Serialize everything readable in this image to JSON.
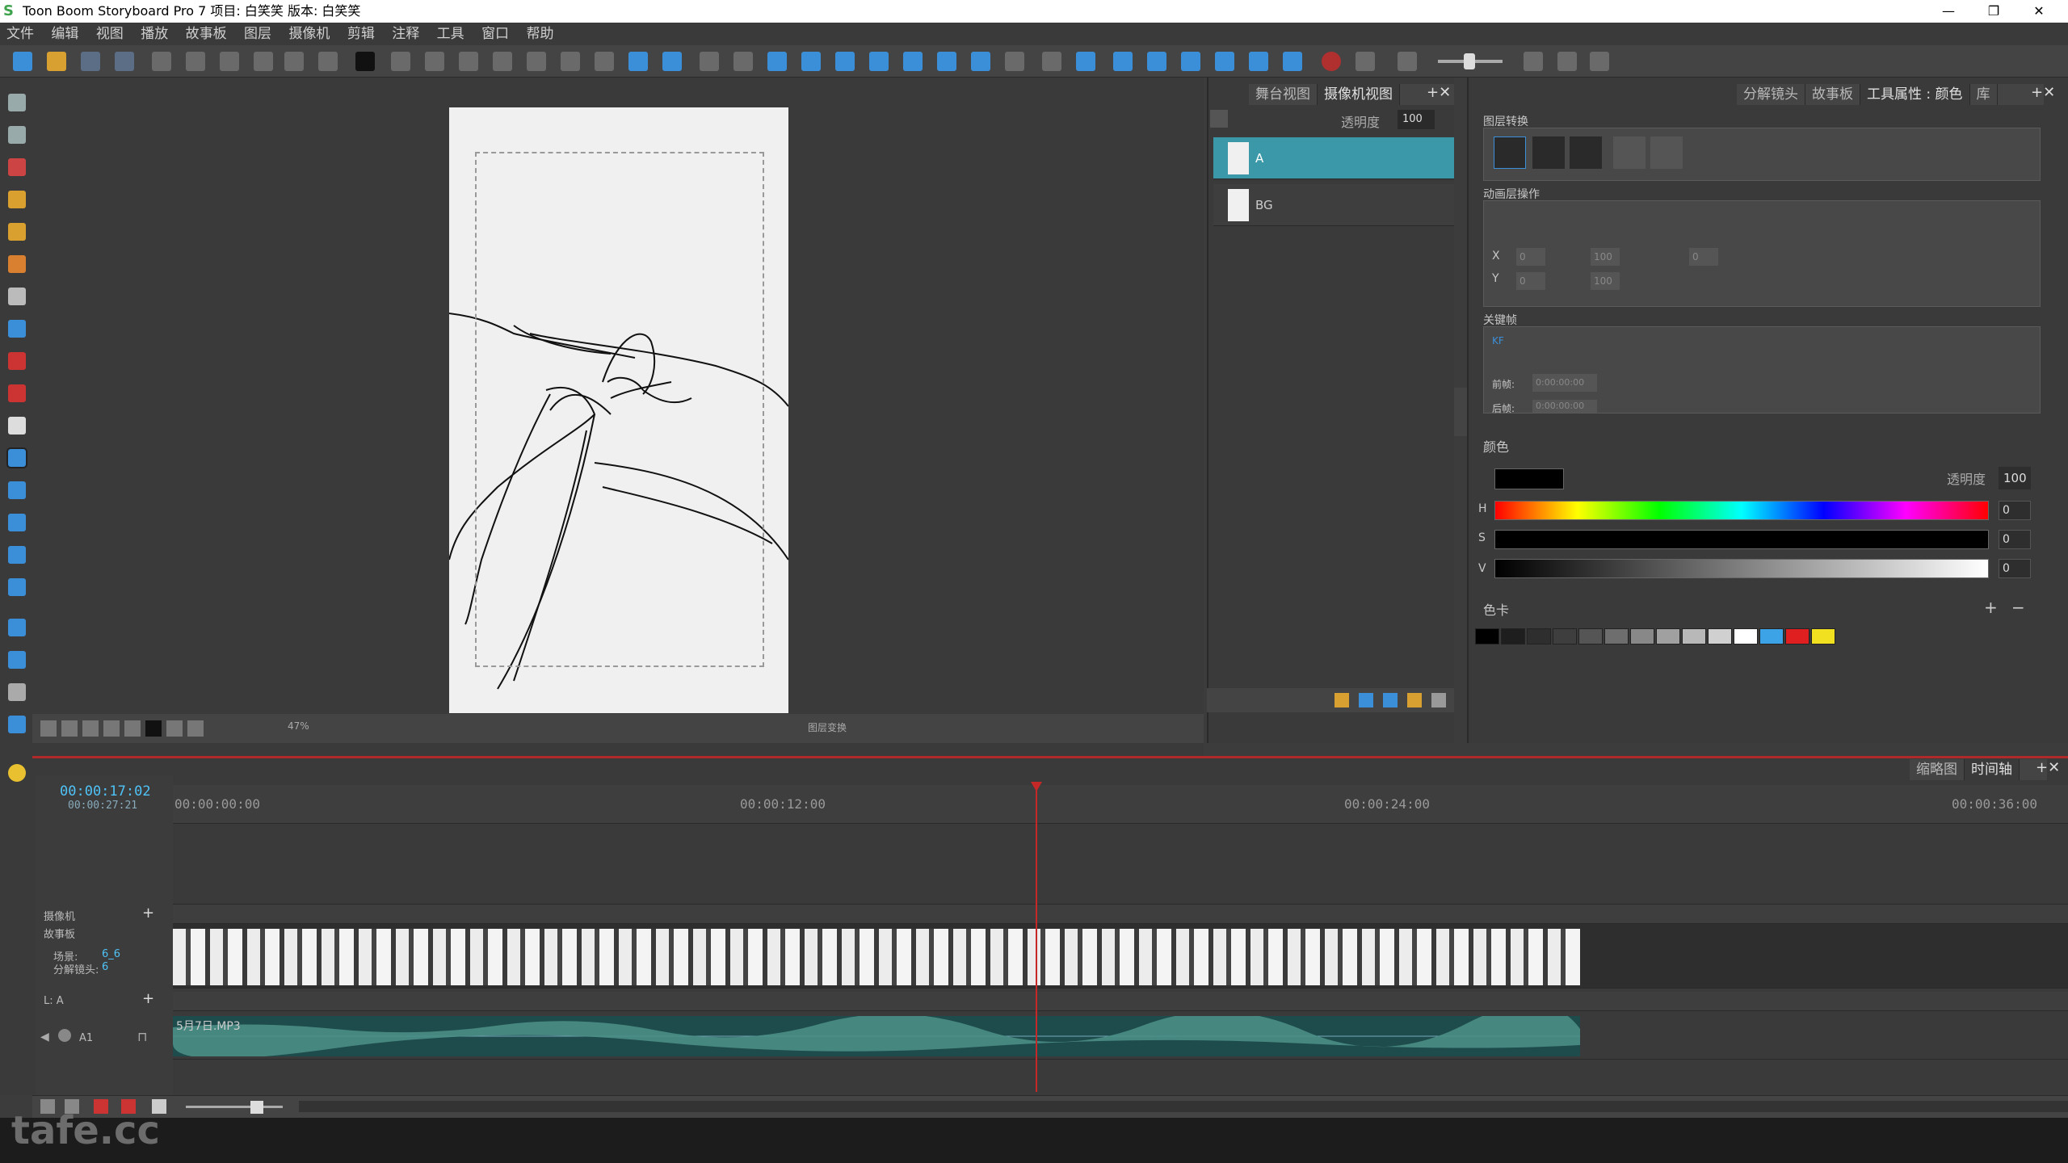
{
  "window": {
    "title": "Toon Boom Storyboard Pro 7 项目: 白笑笑 版本: 白笑笑",
    "minimize": "—",
    "restore": "❐",
    "close": "✕"
  },
  "menu": [
    "文件",
    "编辑",
    "视图",
    "播放",
    "故事板",
    "图层",
    "摄像机",
    "剪辑",
    "注释",
    "工具",
    "窗口",
    "帮助"
  ],
  "stage": {
    "zoom": "47%",
    "bottom_label": "图层变换",
    "tabs": [
      "舞台视图",
      "摄像机视图"
    ]
  },
  "layers": {
    "opacity_label": "透明度",
    "opacity_value": "100",
    "items": [
      {
        "name": "A",
        "selected": true
      },
      {
        "name": "BG",
        "selected": false
      }
    ]
  },
  "right_tabs": [
    "分解镜头",
    "故事板",
    "工具属性 : 颜色",
    "库"
  ],
  "tool_props": {
    "layer_transform_title": "图层转换",
    "anim_ops_title": "动画层操作",
    "x_value": "0",
    "y_value": "0",
    "w_value": "100",
    "h_value": "100",
    "angle_value": "0",
    "keyframes_title": "关键帧",
    "kf_label": "KF",
    "before_label": "前帧:",
    "before_value": "0:00:00:00",
    "after_label": "后帧:",
    "after_value": "0:00:00:00"
  },
  "color": {
    "section": "颜色",
    "opacity_label": "透明度",
    "opacity_value": "100",
    "current": "#000000",
    "h_label": "H",
    "h_value": "0",
    "s_label": "S",
    "s_value": "0",
    "v_label": "V",
    "v_value": "0"
  },
  "palette": {
    "section": "色卡",
    "swatches": [
      "#000000",
      "#1e1e1e",
      "#2e2e2e",
      "#3e3e3e",
      "#555555",
      "#6e6e6e",
      "#888888",
      "#a0a0a0",
      "#b8b8b8",
      "#d0d0d0",
      "#ffffff",
      "#3ba3e6",
      "#e02020",
      "#f0e020"
    ]
  },
  "timeline": {
    "tabs": [
      "缩略图",
      "时间轴"
    ],
    "current_time": "00:00:17:02",
    "total_time": "00:00:27:21",
    "ruler": [
      "00:00:00:00",
      "00:00:12:00",
      "00:00:24:00",
      "00:00:36:00"
    ],
    "camera_track": "摄像机",
    "storyboard_track": "故事板",
    "scene_label": "场景:",
    "scene_value": "6_6",
    "panel_label": "分解镜头:",
    "panel_value": "6",
    "layer_track": "L: A",
    "audio_track": "A1",
    "audio_clip": "5月7日.MP3"
  },
  "watermark": "tafe.cc"
}
